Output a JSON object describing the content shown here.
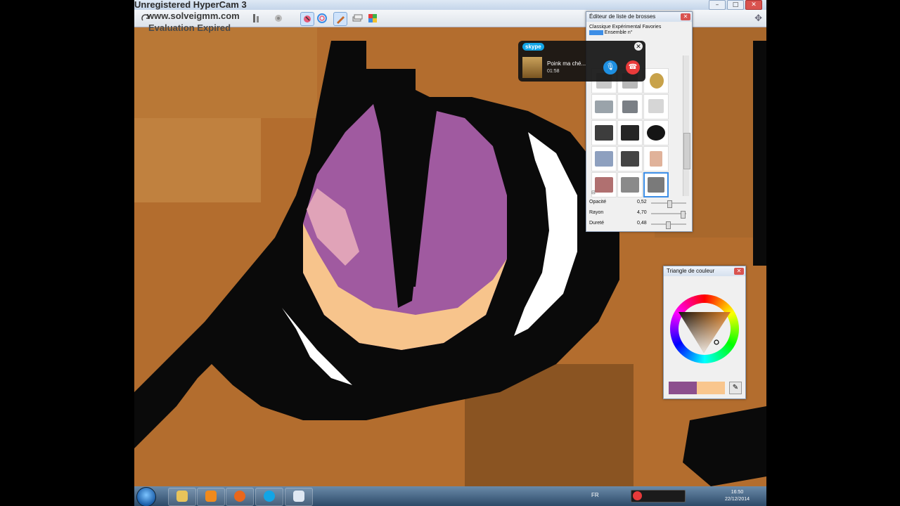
{
  "app": {
    "watermark_title": "Unregistered HyperCam 3",
    "watermark_url": "www.solveigmm.com",
    "watermark_status": "Evaluation Expired"
  },
  "toolbar": {
    "icons": [
      "redo-icon",
      "transform-icon",
      "symmetry-icon",
      "brush-tool-icon",
      "color-circle-icon",
      "pencil-icon",
      "layers-icon",
      "color-palette-icon"
    ]
  },
  "brush_editor": {
    "title": "Éditeur de liste de brosses",
    "tabs": "Classique Expérimental Favories",
    "set_label": "Ensemble n°",
    "sliders": [
      {
        "name": "Opacité",
        "value": "0,52",
        "level": 0.52
      },
      {
        "name": "Rayon",
        "value": "4,70",
        "level": 0.95
      },
      {
        "name": "Dureté",
        "value": "0,48",
        "level": 0.48
      }
    ]
  },
  "color_panel": {
    "title": "Triangle de couleur",
    "primary_color": "#8c4f8e",
    "secondary_color": "#f9c68e"
  },
  "skype": {
    "logo": "skype",
    "caller": "Poink ma ché...",
    "duration": "01:58"
  },
  "taskbar": {
    "apps": [
      "windows-explorer",
      "media-player",
      "firefox",
      "skype",
      "paint"
    ],
    "language": "FR",
    "time": "16:50",
    "date": "22/12/2014"
  }
}
